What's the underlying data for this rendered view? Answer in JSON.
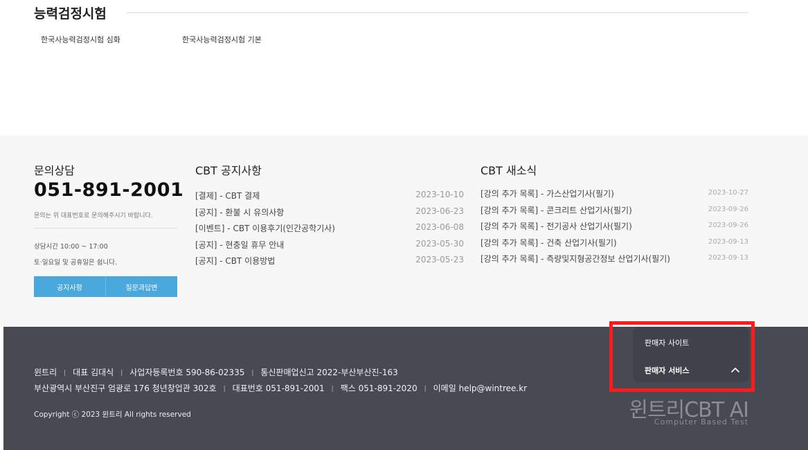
{
  "top": {
    "title": "능력검정시험",
    "links": [
      "한국사능력검정시험 심화",
      "한국사능력검정시험 기본"
    ]
  },
  "contact": {
    "title": "문의상담",
    "phone": "051-891-2001",
    "note": "문의는 위 대표번호로 문의해주시기 바랍니다.",
    "hours": "상담시간 10:00 ~ 17:00",
    "closed": "토·일요일 및 공휴일은 쉽니다.",
    "buttons": [
      "공지사항",
      "질문과답변"
    ]
  },
  "notices": {
    "title": "CBT 공지사항",
    "items": [
      {
        "text": "[결제] - CBT 결제",
        "date": "2023-10-10"
      },
      {
        "text": "[공지] - 환불 시 유의사항",
        "date": "2023-06-23"
      },
      {
        "text": "[이벤트] - CBT 이용후기(인간공학기사)",
        "date": "2023-06-08"
      },
      {
        "text": "[공지] - 현충일 휴무 안내",
        "date": "2023-05-30"
      },
      {
        "text": "[공지] - CBT 이용방법",
        "date": "2023-05-23"
      }
    ]
  },
  "news": {
    "title": "CBT 새소식",
    "items": [
      {
        "text": "[강의 추가 목록] - 가스산업기사(필기)",
        "date": "2023-10-27"
      },
      {
        "text": "[강의 추가 목록] - 콘크리트 산업기사(필기)",
        "date": "2023-09-26"
      },
      {
        "text": "[강의 추가 목록] - 전기공사 산업기사(필기)",
        "date": "2023-09-26"
      },
      {
        "text": "[강의 추가 목록] - 건축 산업기사(필기)",
        "date": "2023-09-13"
      },
      {
        "text": "[강의 추가 목록] - 측량및지형공간정보 산업기사(필기)",
        "date": "2023-09-13"
      }
    ]
  },
  "footer": {
    "company": "윈트리",
    "ceo": "대표 김대식",
    "biz_no": "사업자등록번호 590-86-02335",
    "sales_no": "통신판매업신고 2022-부산부산진-163",
    "address": "부산광역시 부산진구 엄광로 176 청년창업관 302호",
    "tel": "대표번호 051-891-2001",
    "fax": "팩스 051-891-2020",
    "email": "이메일 help@wintree.kr",
    "separator": "|",
    "copyright": "Copyright ⓒ 2023 윈트리 All rights reserved",
    "seller_site": "판매자 사이트",
    "seller_service": "판매자 서비스",
    "brand": "윈트리CBT AI",
    "brand_sub": "Computer Based Test",
    "highlight_color": "#ff1b1b"
  }
}
